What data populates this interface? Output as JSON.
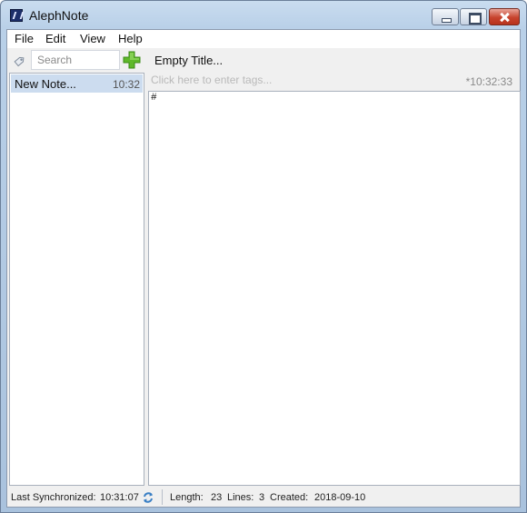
{
  "window": {
    "title": "AlephNote",
    "icon": "alephnote-logo-icon"
  },
  "menu": {
    "items": [
      {
        "label": "File"
      },
      {
        "label": "Edit"
      },
      {
        "label": "View"
      },
      {
        "label": "Help"
      }
    ]
  },
  "search": {
    "placeholder": "Search",
    "value": ""
  },
  "notes": [
    {
      "title": "New Note...",
      "time": "10:32",
      "selected": true
    }
  ],
  "editor": {
    "title": "Empty Title...",
    "tags_placeholder": "Click here to enter tags...",
    "modified_time": "*10:32:33",
    "content": "#"
  },
  "status": {
    "last_sync_label": "Last Synchronized:",
    "last_sync_value": "10:31:07",
    "length_label": "Length:",
    "length_value": "23",
    "lines_label": "Lines:",
    "lines_value": "3",
    "created_label": "Created:",
    "created_value": "2018-09-10"
  },
  "colors": {
    "selection": "#ccdcef",
    "add_button": "#5fb82a",
    "close_button": "#c7432d",
    "sync_icon": "#3a7fc4"
  }
}
